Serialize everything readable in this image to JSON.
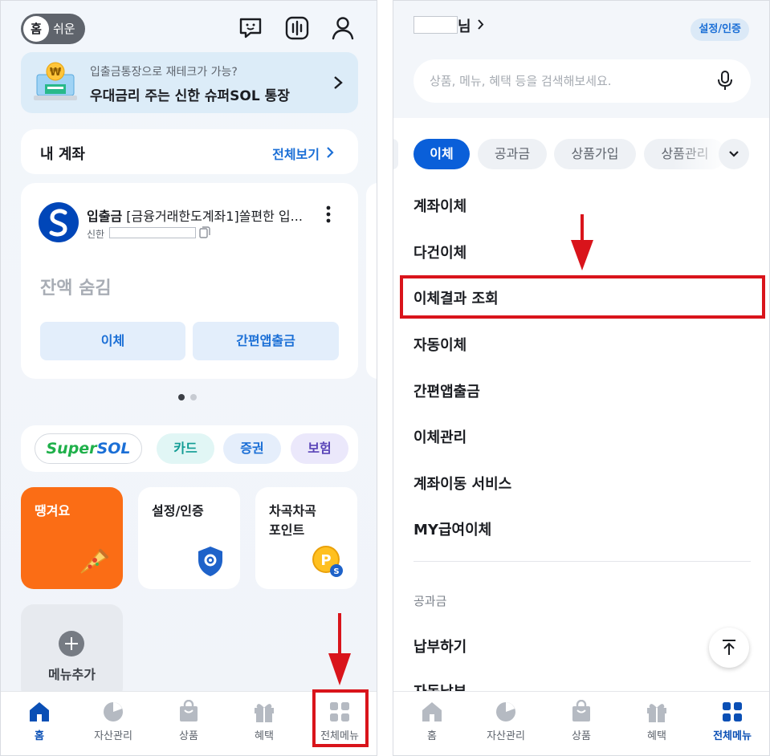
{
  "left": {
    "mode_toggle": {
      "home": "홈",
      "easy": "쉬운"
    },
    "banner": {
      "subtitle": "입출금통장으로 재테크가 가능?",
      "title": "우대금리 주는 신한 슈퍼SOL 통장"
    },
    "my_account": {
      "title": "내 계좌",
      "view_all": "전체보기"
    },
    "account_card": {
      "type": "입출금",
      "name": "[금융거래한도계좌1]쏠편한 입...",
      "bank": "신한",
      "balance": "잔액 숨김",
      "transfer_btn": "이체",
      "easy_btn": "간편앱출금"
    },
    "pills": {
      "supersol_a": "Super",
      "supersol_b": "SOL",
      "card": "카드",
      "stock": "증권",
      "insurance": "보험"
    },
    "tiles": {
      "ttang": "땡겨요",
      "settings": "설정/인증",
      "points_l1": "차곡차곡",
      "points_l2": "포인트",
      "add": "메뉴추가"
    },
    "tabbar": {
      "home": "홈",
      "asset": "자산관리",
      "product": "상품",
      "benefit": "혜택",
      "all_menu": "전체메뉴"
    }
  },
  "right": {
    "header": {
      "suffix": "님",
      "setcert": "설정/인증"
    },
    "search": {
      "placeholder": "상품, 메뉴, 혜택 등을 검색해보세요."
    },
    "chips": [
      "이체",
      "공과금",
      "상품가입",
      "상품관리"
    ],
    "menu": [
      "계좌이체",
      "다건이체",
      "이체결과 조회",
      "자동이체",
      "간편앱출금",
      "이체관리",
      "계좌이동 서비스",
      "MY급여이체"
    ],
    "section_title": "공과금",
    "section_items": [
      "납부하기",
      "자동납부"
    ],
    "tabbar": {
      "home": "홈",
      "asset": "자산관리",
      "product": "상품",
      "benefit": "혜택",
      "all_menu": "전체메뉴"
    }
  },
  "colors": {
    "brand_blue": "#0a5fd9",
    "link_blue": "#1b6fd6",
    "highlight_red": "#d9141b",
    "orange": "#fb6d15"
  }
}
